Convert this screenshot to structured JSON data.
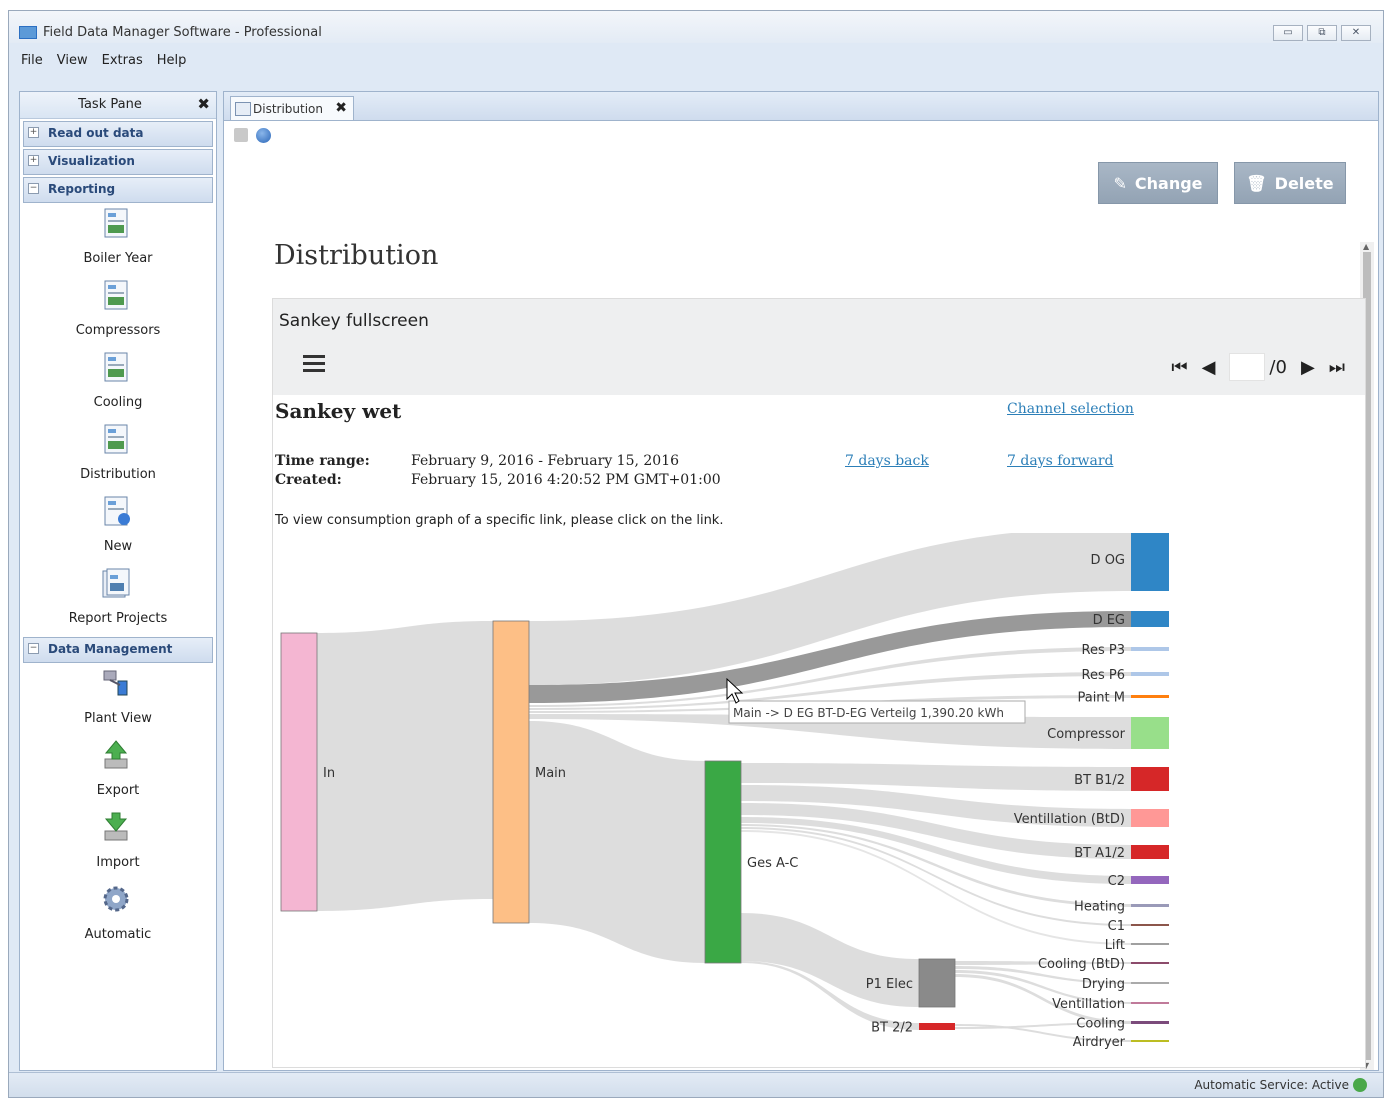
{
  "window": {
    "title": "Field Data Manager Software - Professional",
    "controls": [
      "▭",
      "⧉",
      "✕"
    ]
  },
  "menu": [
    "File",
    "View",
    "Extras",
    "Help"
  ],
  "taskpane": {
    "title": "Task Pane",
    "close": "✖",
    "sections": {
      "read": {
        "toggle": "+",
        "label": "Read out data"
      },
      "visual": {
        "toggle": "+",
        "label": "Visualization"
      },
      "reporting": {
        "toggle": "−",
        "label": "Reporting"
      },
      "datamgmt": {
        "toggle": "−",
        "label": "Data Management"
      }
    },
    "reporting_items": [
      "Boiler Year",
      "Compressors",
      "Cooling",
      "Distribution",
      "New",
      "Report Projects"
    ],
    "data_items": [
      "Plant View",
      "Export",
      "Import",
      "Automatic"
    ]
  },
  "tab": {
    "label": "Distribution",
    "close": "✖"
  },
  "buttons": {
    "change": "Change",
    "change_icon": "✎",
    "delete": "Delete",
    "delete_icon": "🗑"
  },
  "page_title": "Distribution",
  "panel": {
    "title": "Sankey fullscreen",
    "pager": {
      "first": "⏮",
      "prev": "◀",
      "total": "/0",
      "next": "▶",
      "last": "⏭"
    },
    "report_title": "Sankey wet",
    "channel_selection": "Channel selection",
    "time_range_label": "Time range:",
    "time_range_value": "February 9, 2016 - February 15, 2016",
    "created_label": "Created:",
    "created_value": "February 15, 2016 4:20:52 PM GMT+01:00",
    "days_back": "7 days back",
    "days_forward": "7 days forward",
    "hint": "To view consumption graph of a specific link, please click on the link.",
    "tooltip": "Main -> D EG BT-D-EG Verteilg 1,390.20 kWh"
  },
  "sankey": {
    "nodes": [
      {
        "id": "in",
        "label": "In",
        "color": "#f4b6d2"
      },
      {
        "id": "main",
        "label": "Main",
        "color": "#fdbf86"
      },
      {
        "id": "ges",
        "label": "Ges A-C",
        "color": "#3aa845"
      },
      {
        "id": "p1",
        "label": "P1 Elec",
        "color": "#8a8a8a"
      },
      {
        "id": "bt22",
        "label": "BT 2/2",
        "color": "#d62728"
      },
      {
        "id": "dog",
        "label": "D OG",
        "color": "#2f86c6"
      },
      {
        "id": "deg",
        "label": "D EG",
        "color": "#2f86c6"
      },
      {
        "id": "resp3",
        "label": "Res P3",
        "color": "#aec7e8"
      },
      {
        "id": "resp6",
        "label": "Res P6",
        "color": "#aec7e8"
      },
      {
        "id": "paint",
        "label": "Paint M",
        "color": "#ff7f0e"
      },
      {
        "id": "comp",
        "label": "Compressor",
        "color": "#98df8a"
      },
      {
        "id": "btb12",
        "label": "BT B1/2",
        "color": "#d62728"
      },
      {
        "id": "vent",
        "label": "Ventillation (BtD)",
        "color": "#ff9896"
      },
      {
        "id": "bta12",
        "label": "BT A1/2",
        "color": "#d62728"
      },
      {
        "id": "c2",
        "label": "C2",
        "color": "#9467bd"
      },
      {
        "id": "heat",
        "label": "Heating",
        "color": "#9a9ab8"
      },
      {
        "id": "c1",
        "label": "C1",
        "color": "#8c564b"
      },
      {
        "id": "lift",
        "label": "Lift",
        "color": "#a0a0a0"
      },
      {
        "id": "coolbtd",
        "label": "Cooling (BtD)",
        "color": "#8c4b6b"
      },
      {
        "id": "drying",
        "label": "Drying",
        "color": "#aaaaaa"
      },
      {
        "id": "ventil",
        "label": "Ventillation",
        "color": "#c07a9a"
      },
      {
        "id": "cooling",
        "label": "Cooling",
        "color": "#7b4b7b"
      },
      {
        "id": "airdryer",
        "label": "Airdryer",
        "color": "#bcbd22"
      }
    ]
  },
  "status": {
    "text": "Automatic Service: Active"
  }
}
